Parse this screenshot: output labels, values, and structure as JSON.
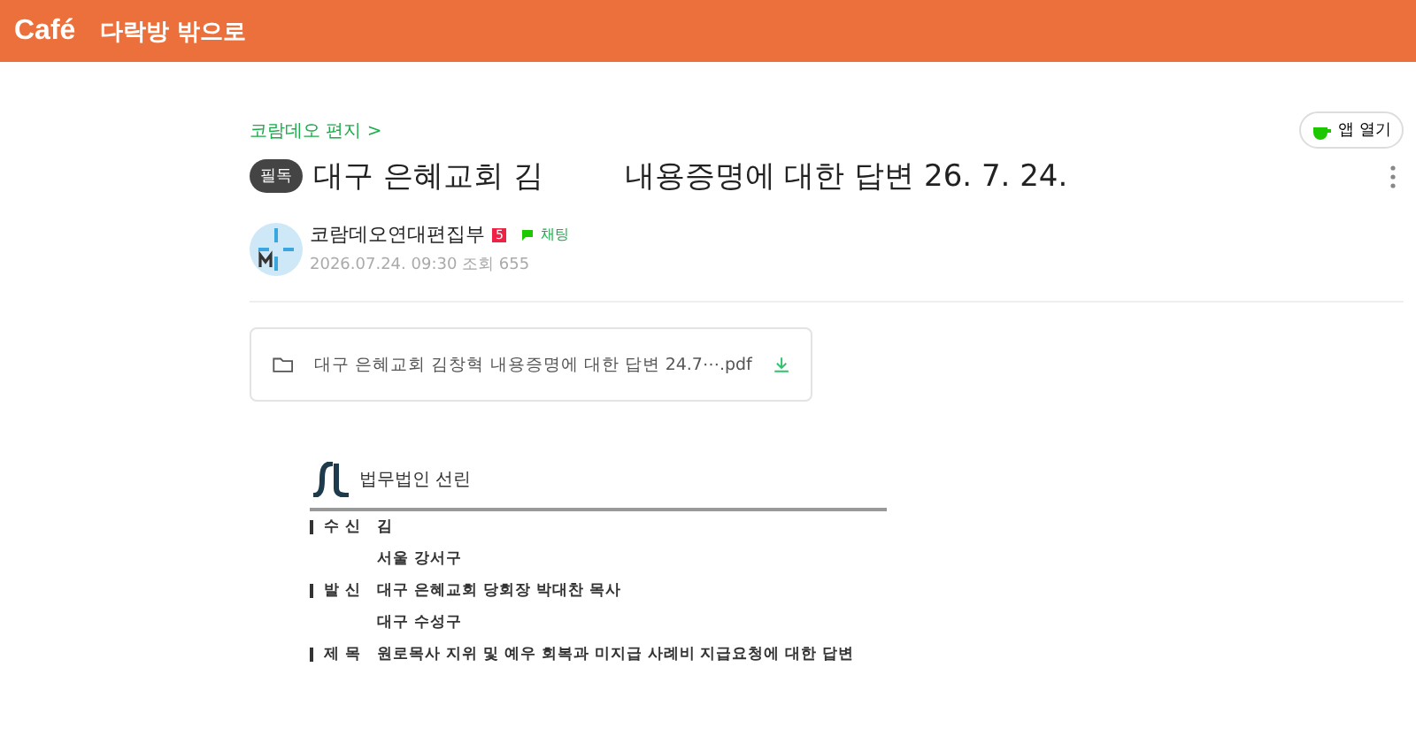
{
  "header": {
    "logo": "Café",
    "exit_link": "다락방 밖으로"
  },
  "post": {
    "board_link": "코람데오 편지 >",
    "app_button": "앱 열기",
    "badge": "필독",
    "title_parts": [
      "대구 은혜교회 김",
      "내용증명에 대한 답변 26. 7. 24."
    ],
    "author": {
      "name": "코람데오연대편집부",
      "level_badge": "5",
      "chat": "채팅",
      "meta": "2026.07.24. 09:30 조회 655"
    },
    "attachment": {
      "filename": "대구 은혜교회 김창혁 내용증명에 대한 답변 24.7⋯.pdf"
    },
    "document": {
      "firm": "법무법인 선린",
      "rows": [
        {
          "label": "수 신",
          "value": "김"
        },
        {
          "label": "",
          "value": "서울 강서구"
        },
        {
          "label": "발 신",
          "value": "대구 은혜교회 당회장 박대찬 목사"
        },
        {
          "label": "",
          "value": "대구 수성구"
        },
        {
          "label": "제 목",
          "value": "원로목사 지위 및 예우 회복과 미지급 사례비 지급요청에 대한 답변"
        }
      ]
    }
  }
}
